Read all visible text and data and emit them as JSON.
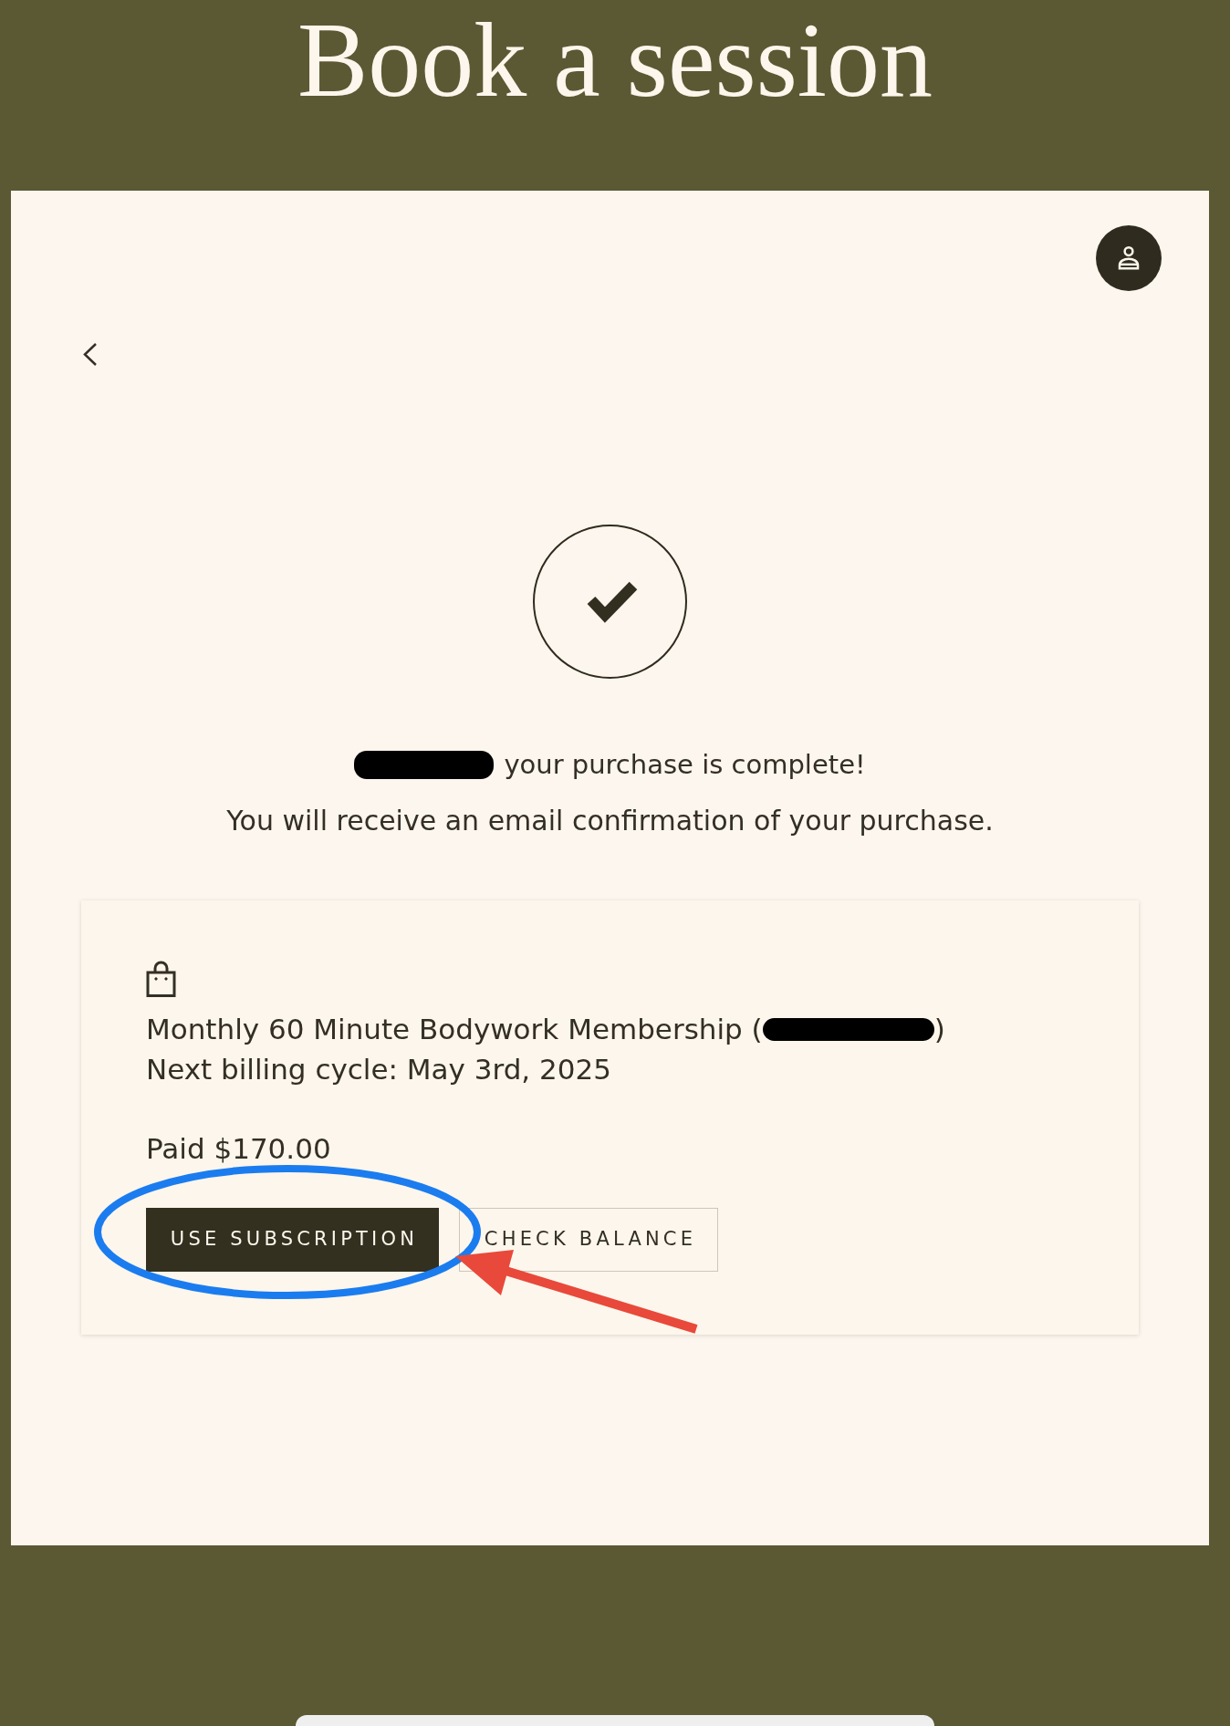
{
  "header": {
    "title": "Book a session"
  },
  "confirmation": {
    "headline": [
      {
        "kind": "redaction"
      },
      {
        "kind": "text",
        "text": "your purchase is complete!"
      }
    ],
    "message": "You will receive an email confirmation of your purchase."
  },
  "order_card": {
    "item_line": [
      {
        "kind": "text",
        "text": "Monthly 60 Minute Bodywork Membership ("
      },
      {
        "kind": "redaction"
      },
      {
        "kind": "text",
        "text": ")"
      }
    ],
    "billing": "Next billing cycle: May 3rd, 2025",
    "paid": "Paid $170.00",
    "buttons": [
      {
        "label": "USE SUBSCRIPTION",
        "kind": "primary"
      },
      {
        "label": "CHECK BALANCE",
        "kind": "outline"
      }
    ]
  },
  "annotations": [
    {
      "kind": "ellipse"
    },
    {
      "kind": "arrow"
    }
  ]
}
